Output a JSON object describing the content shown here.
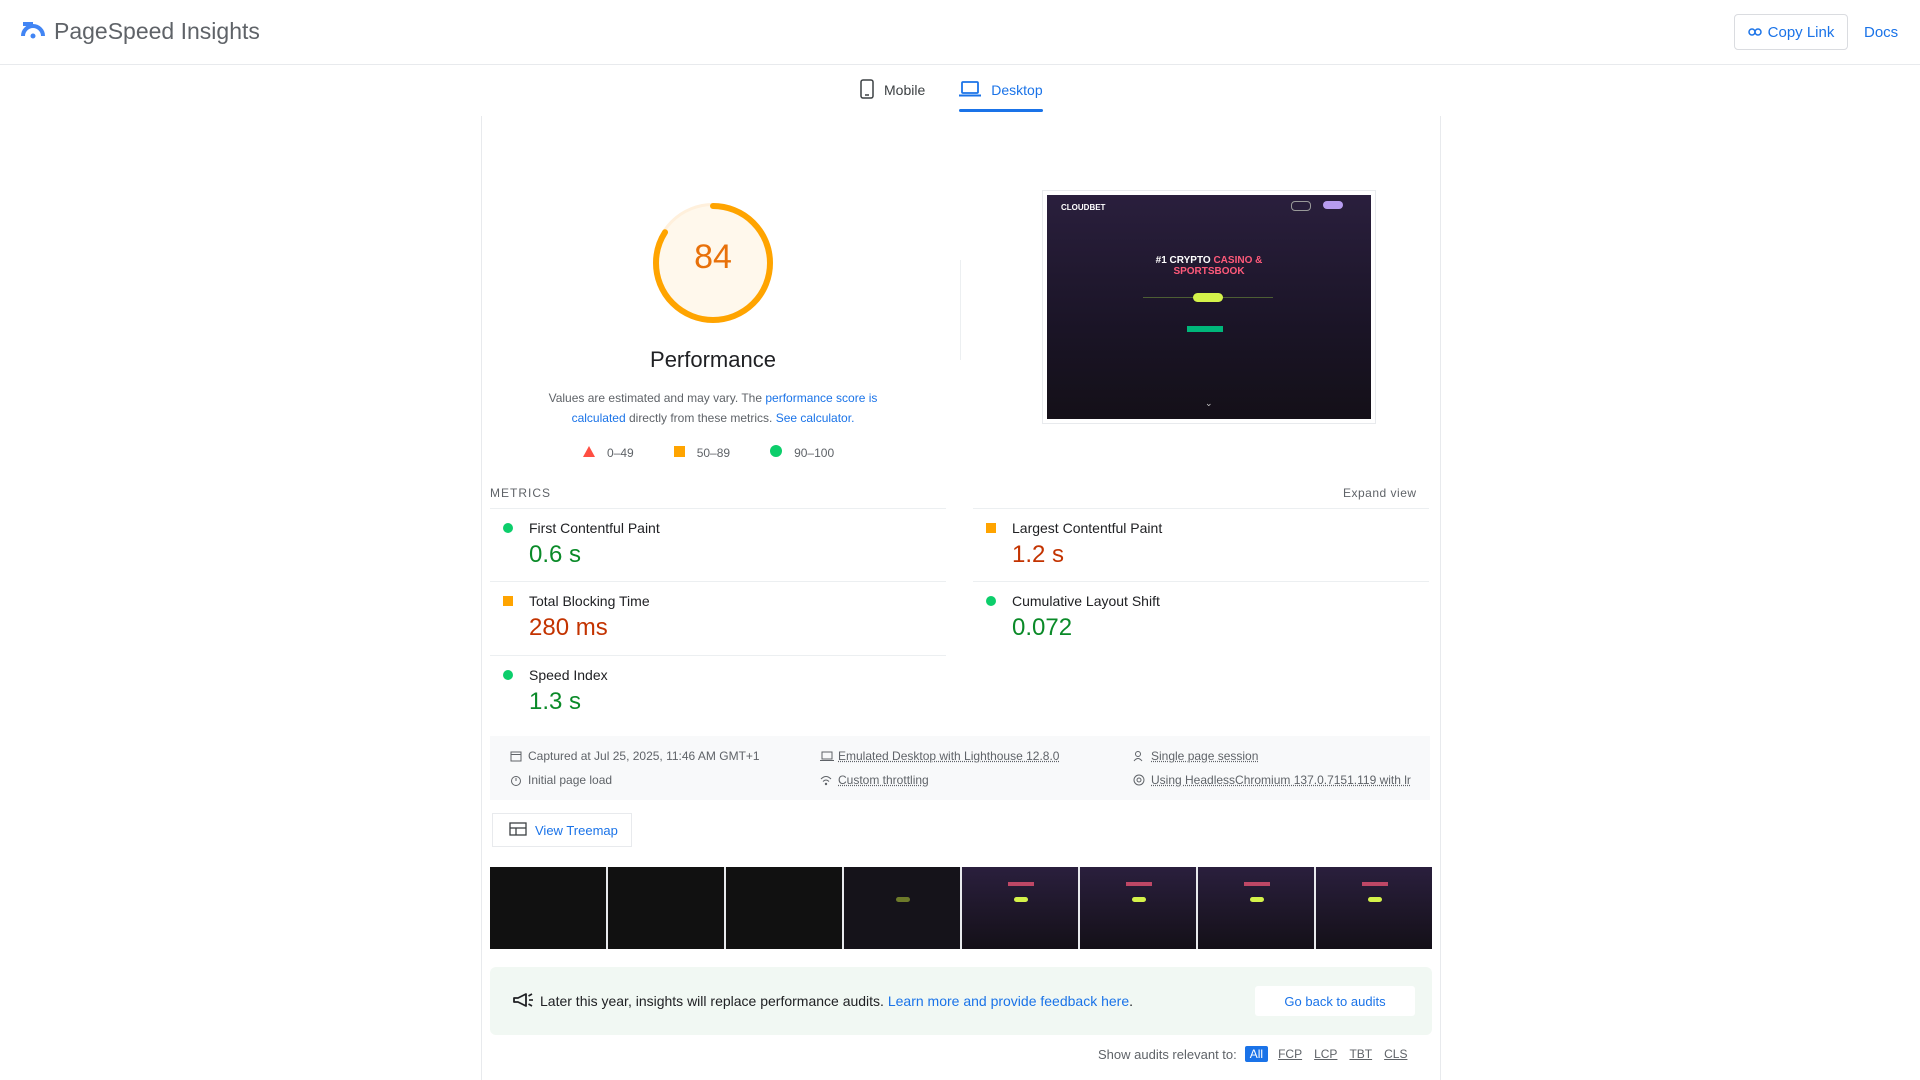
{
  "header": {
    "title": "PageSpeed Insights",
    "copy_link": "Copy Link",
    "docs": "Docs"
  },
  "tabs": [
    {
      "label": "Mobile"
    },
    {
      "label": "Desktop"
    }
  ],
  "performance": {
    "score": "84",
    "title": "Performance",
    "desc_prefix": "Values are estimated and may vary. The ",
    "desc_link1": "performance score is calculated",
    "desc_mid": " directly from these metrics. ",
    "desc_link2": "See calculator.",
    "legend": [
      "0–49",
      "50–89",
      "90–100"
    ]
  },
  "screenshot": {
    "brand": "CLOUDBET",
    "headline_1": "#1 CRYPTO",
    "headline_accent": "CASINO &",
    "headline_2": "SPORTSBOOK"
  },
  "metrics": {
    "label": "METRICS",
    "expand": "Expand view",
    "items": [
      {
        "name": "First Contentful Paint",
        "value": "0.6 s",
        "rating": "good"
      },
      {
        "name": "Largest Contentful Paint",
        "value": "1.2 s",
        "rating": "average"
      },
      {
        "name": "Total Blocking Time",
        "value": "280 ms",
        "rating": "average"
      },
      {
        "name": "Cumulative Layout Shift",
        "value": "0.072",
        "rating": "good"
      },
      {
        "name": "Speed Index",
        "value": "1.3 s",
        "rating": "good"
      }
    ]
  },
  "info": {
    "captured": "Captured at Jul 25, 2025, 11:46 AM GMT+1",
    "emulated": "Emulated Desktop with Lighthouse 12.8.0",
    "session": "Single page session",
    "initial": "Initial page load",
    "throttling": "Custom throttling",
    "browser": "Using HeadlessChromium 137.0.7151.119 with lr"
  },
  "treemap": "View Treemap",
  "notice": {
    "text": "Later this year, insights will replace performance audits. ",
    "link": "Learn more and provide feedback here",
    "period": ".",
    "button": "Go back to audits"
  },
  "filter": {
    "label": "Show audits relevant to:",
    "chips": [
      "All",
      "FCP",
      "LCP",
      "TBT",
      "CLS"
    ]
  },
  "colors": {
    "accent": "#1a73e8",
    "good": "#0cce6b",
    "average": "#ffa400",
    "poor": "#ff4e42",
    "score": "#e8710a"
  }
}
